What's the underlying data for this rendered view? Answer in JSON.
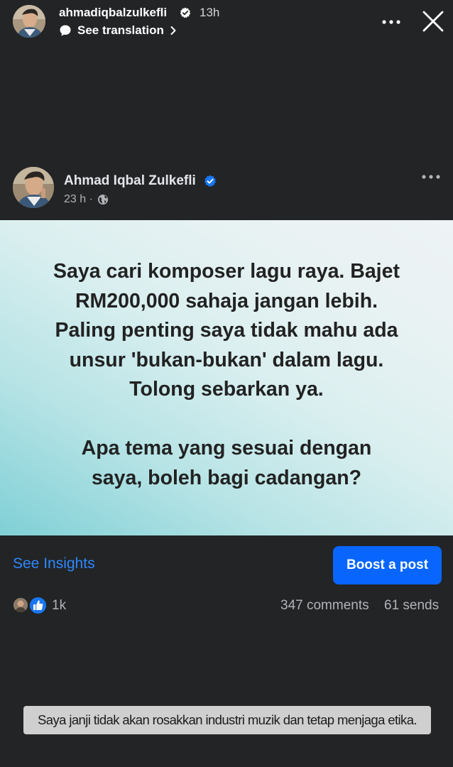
{
  "story": {
    "username": "ahmadiqbalzulkefli",
    "time": "13h",
    "translation_label": "See translation"
  },
  "post": {
    "author": "Ahmad Iqbal Zulkefli",
    "time": "23 h ·",
    "image_text": {
      "line1": "Saya cari komposer lagu raya. Bajet",
      "line2": "RM200,000 sahaja jangan lebih.",
      "line3": "Paling penting saya tidak mahu ada",
      "line4": "unsur 'bukan-bukan' dalam lagu.",
      "line5": "Tolong sebarkan ya.",
      "line6": "Apa tema yang sesuai dengan",
      "line7": "saya, boleh bagi cadangan?"
    }
  },
  "actions": {
    "insights_label": "See Insights",
    "boost_label": "Boost a post"
  },
  "stats": {
    "reactions": "1k",
    "comments": "347 comments",
    "sends": "61 sends"
  },
  "caption": "Saya janji tidak akan rosakkan industri muzik dan tetap menjaga etika.",
  "colors": {
    "background": "#222426",
    "link_blue": "#2d88ff",
    "boost_blue": "#0866ff",
    "verified_blue": "#1877f2"
  },
  "icons": [
    "verified-badge-icon",
    "translate-icon",
    "chevron-right-icon",
    "more-icon",
    "close-icon",
    "globe-icon",
    "like-icon"
  ]
}
